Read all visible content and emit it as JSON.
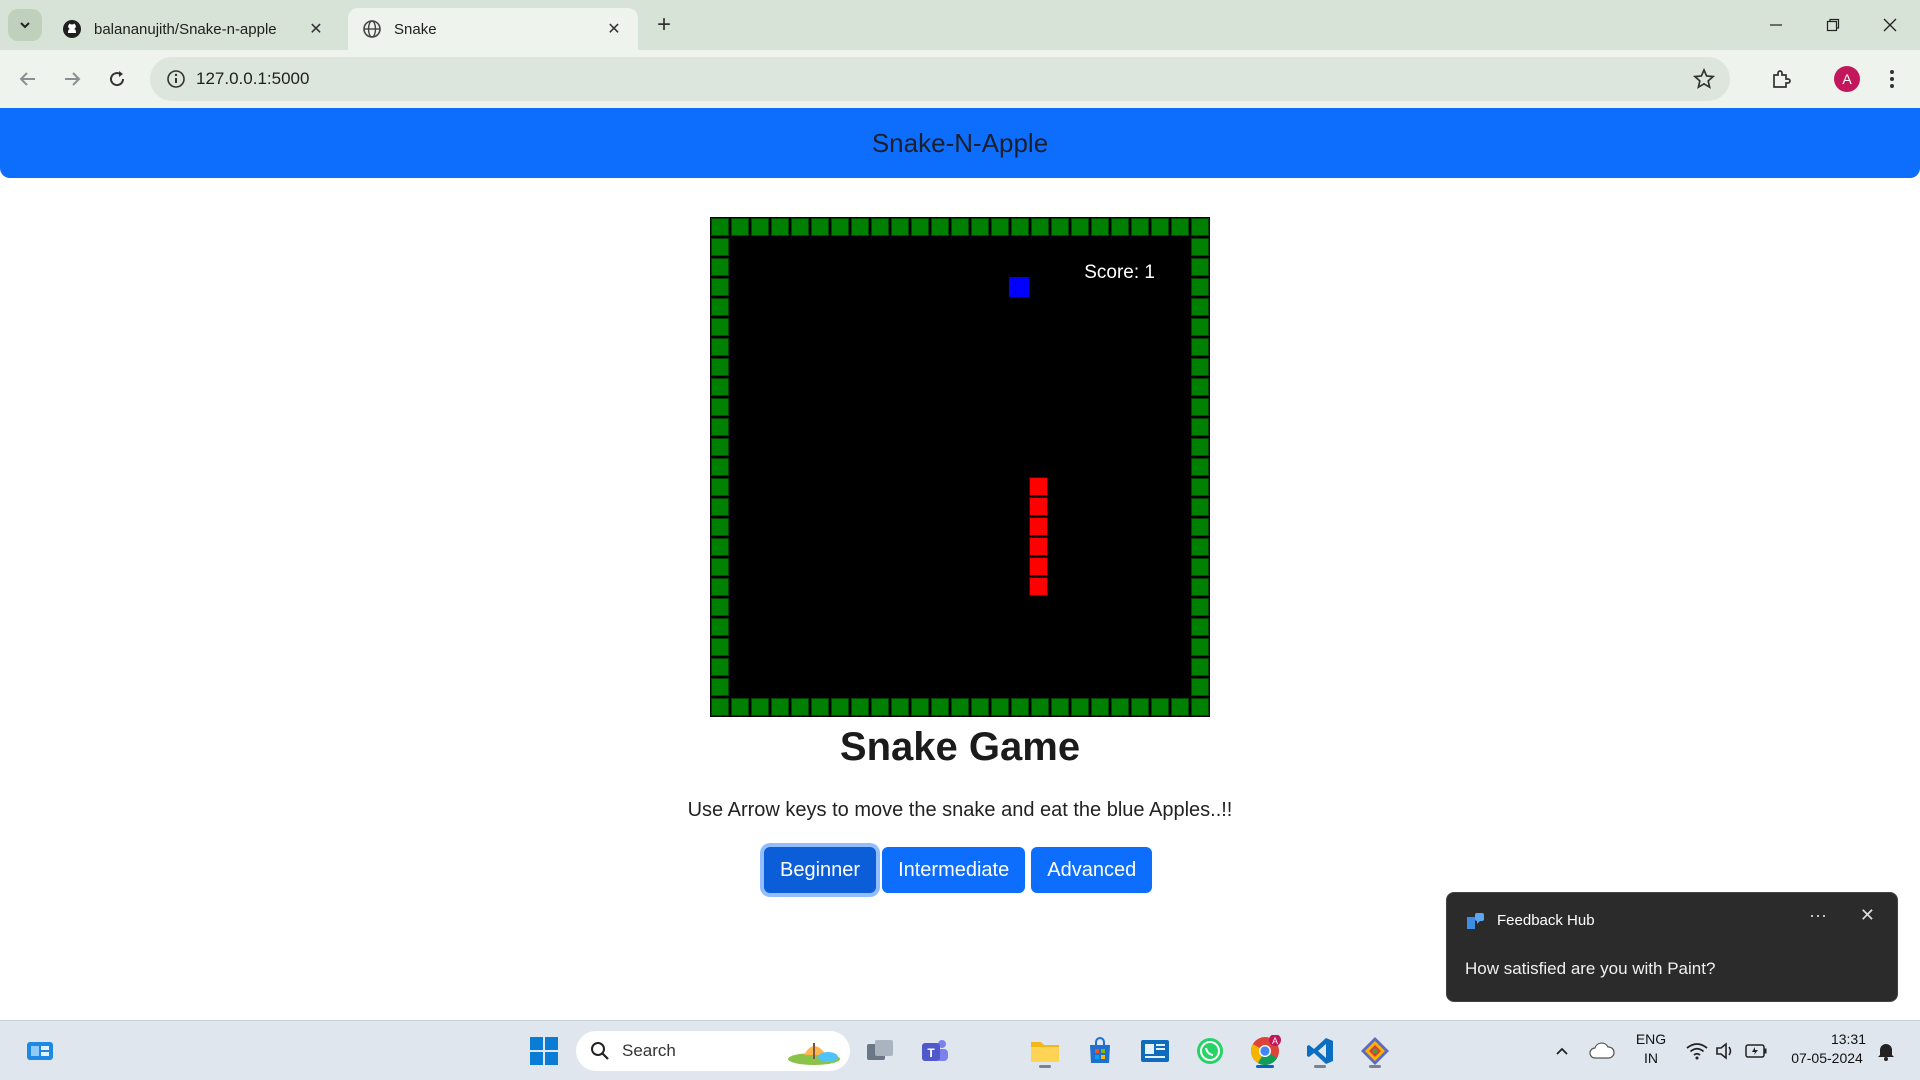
{
  "browser": {
    "tabs": [
      {
        "title": "balananujith/Snake-n-apple",
        "icon": "github-icon"
      },
      {
        "title": "Snake",
        "icon": "globe-icon"
      }
    ],
    "url": "127.0.0.1:5000",
    "profile_initial": "A"
  },
  "page": {
    "brand": "Snake-N-Apple",
    "score_text": "Score: 1",
    "heading": "Snake Game",
    "instructions": "Use Arrow keys to move the snake and eat the blue Apples..!!",
    "levels": [
      {
        "label": "Beginner",
        "selected": true
      },
      {
        "label": "Intermediate",
        "selected": false
      },
      {
        "label": "Advanced",
        "selected": false
      }
    ],
    "colors": {
      "wall": "#008000",
      "snake": "#ff0000",
      "apple": "#0000ff",
      "primary": "#0d6efd"
    }
  },
  "toast": {
    "app": "Feedback Hub",
    "message": "How satisfied are you with Paint?"
  },
  "taskbar": {
    "search_placeholder": "Search",
    "lang_line1": "ENG",
    "lang_line2": "IN",
    "time": "13:31",
    "date": "07-05-2024",
    "chrome_badge": "A"
  }
}
